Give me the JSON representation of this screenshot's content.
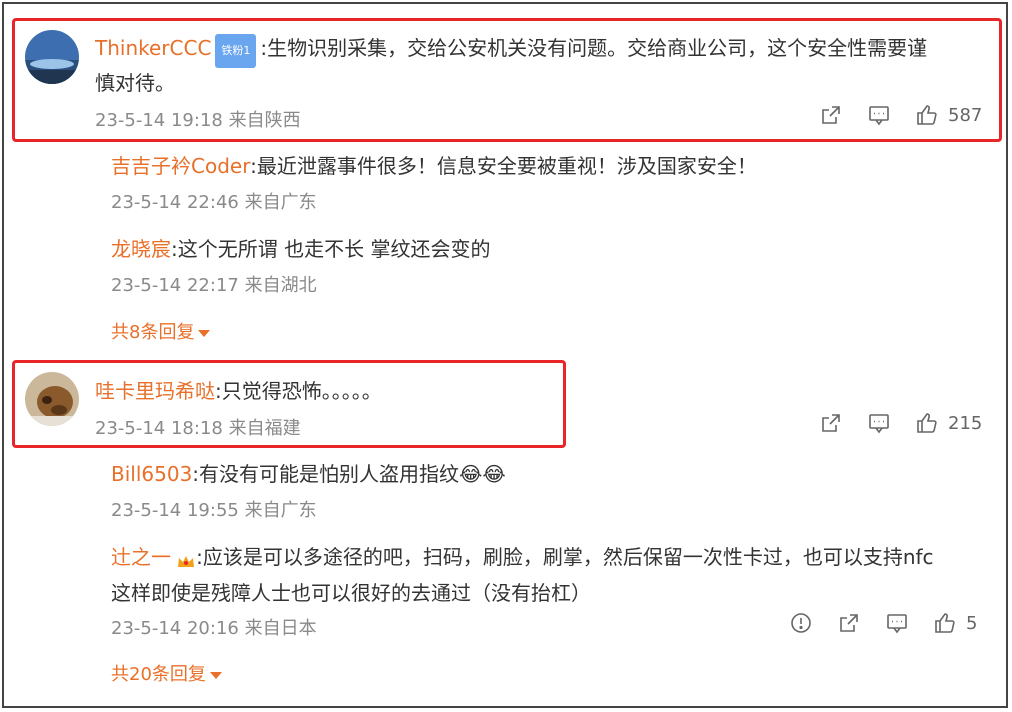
{
  "comments": [
    {
      "user": "ThinkerCCC",
      "badge": "铁粉1",
      "text": ":生物识别采集，交给公安机关没有问题。交给商业公司，这个安全性需要谨慎对待。",
      "text_line1": ":生物识别采集，交给公安机关没有问题。交给商业公司，这个安全性需要谨",
      "text_line2": "慎对待。",
      "meta": "23-5-14 19:18 来自陕西",
      "likes": "587",
      "replies": [
        {
          "user": "吉吉子衿Coder",
          "text": ":最近泄露事件很多！信息安全要被重视！涉及国家安全！",
          "meta": "23-5-14 22:46 来自广东"
        },
        {
          "user": "龙晓宸",
          "text": ":这个无所谓 也走不长 掌纹还会变的",
          "meta": "23-5-14 22:17 来自湖北"
        }
      ],
      "more": "共8条回复"
    },
    {
      "user": "哇卡里玛希哒",
      "text": ":只觉得恐怖。。。。。",
      "meta": "23-5-14 18:18 来自福建",
      "likes": "215",
      "replies": [
        {
          "user": "Bill6503",
          "text": ":有没有可能是怕别人盗用指纹😂😂",
          "meta": "23-5-14 19:55 来自广东"
        },
        {
          "user": "辻之一",
          "text_line1": ":应该是可以多途径的吧，扫码，刷脸，刷掌，然后保留一次性卡过，也可以支持nfc",
          "text_line2": "这样即使是残障人士也可以很好的去通过（没有抬杠）",
          "meta": "23-5-14 20:16 来自日本",
          "likes": "5"
        }
      ],
      "more": "共20条回复"
    }
  ]
}
